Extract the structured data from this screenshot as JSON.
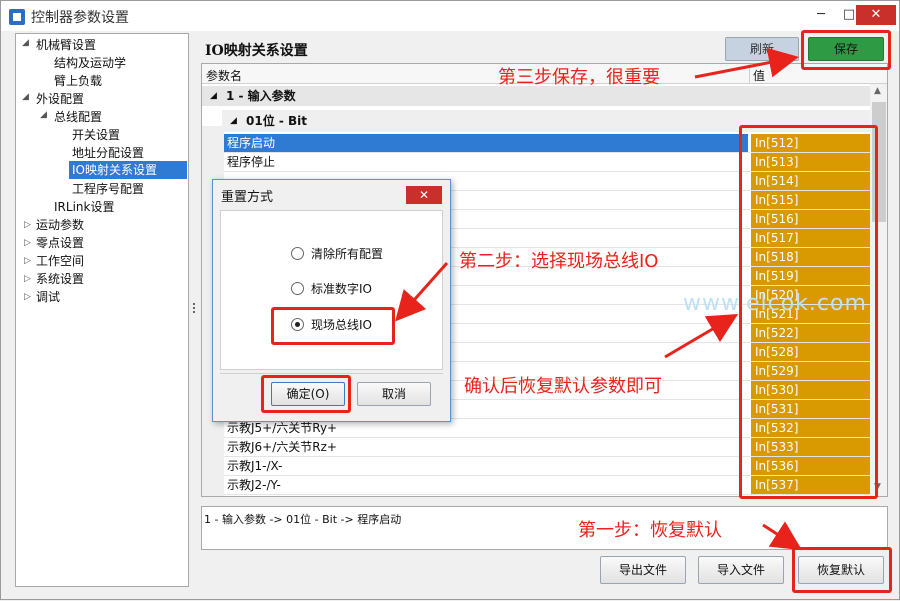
{
  "window": {
    "title": "控制器参数设置",
    "min_icon": "minimize-icon",
    "max_icon": "maximize-icon",
    "close_icon": "close-icon"
  },
  "sidebar": {
    "items": [
      {
        "label": "机械臂设置",
        "expanded": true
      },
      {
        "label": "结构及运动学"
      },
      {
        "label": "臂上负载"
      },
      {
        "label": "外设配置",
        "expanded": true
      },
      {
        "label": "总线配置",
        "expanded": true
      },
      {
        "label": "开关设置"
      },
      {
        "label": "地址分配设置"
      },
      {
        "label": "IO映射关系设置",
        "selected": true
      },
      {
        "label": "工程序号配置"
      },
      {
        "label": "IRLink设置"
      },
      {
        "label": "运动参数",
        "expanded": false
      },
      {
        "label": "零点设置",
        "expanded": false
      },
      {
        "label": "工作空间",
        "expanded": false
      },
      {
        "label": "系统设置",
        "expanded": false
      },
      {
        "label": "调试",
        "expanded": false
      }
    ]
  },
  "main": {
    "title": "IO映射关系设置",
    "refresh_label": "刷新",
    "save_label": "保存",
    "grid": {
      "col_name": "参数名",
      "col_value": "值",
      "group_label": "1 - 输入参数",
      "subgroup_label": "01位 - Bit",
      "rows": [
        {
          "name": "程序启动",
          "value": "In[512]",
          "selected": true
        },
        {
          "name": "程序停止",
          "value": "In[513]"
        },
        {
          "name": "",
          "value": "In[514]"
        },
        {
          "name": "",
          "value": "In[515]"
        },
        {
          "name": "",
          "value": "In[516]"
        },
        {
          "name": "",
          "value": "In[517]"
        },
        {
          "name": "",
          "value": "In[518]"
        },
        {
          "name": "",
          "value": "In[519]"
        },
        {
          "name": "",
          "value": "In[520]"
        },
        {
          "name": "",
          "value": "In[521]"
        },
        {
          "name": "",
          "value": "In[522]"
        },
        {
          "name": "",
          "value": "In[528]"
        },
        {
          "name": "",
          "value": "In[529]"
        },
        {
          "name": "",
          "value": "In[530]"
        },
        {
          "name": "",
          "value": "In[531]"
        },
        {
          "name": "示教J5+/六关节Ry+",
          "value": "In[532]"
        },
        {
          "name": "示教J6+/六关节Rz+",
          "value": "In[533]"
        },
        {
          "name": "示教J1-/X-",
          "value": "In[536]"
        },
        {
          "name": "示教J2-/Y-",
          "value": "In[537]"
        }
      ]
    },
    "description": "1 - 输入参数 -> 01位 - Bit -> 程序启动",
    "export_label": "导出文件",
    "import_label": "导入文件",
    "restore_label": "恢复默认"
  },
  "dialog": {
    "title": "重置方式",
    "options": [
      "清除所有配置",
      "标准数字IO",
      "现场总线IO"
    ],
    "selected_option": "现场总线IO",
    "ok_label": "确定(O)",
    "cancel_label": "取消"
  },
  "annotations": {
    "step1": "第一步：恢复默认",
    "step2": "第二步：选择现场总线IO",
    "step3": "第三步保存，很重要",
    "confirm": "确认后恢复默认参数即可",
    "color": "#e8231b"
  },
  "watermark": "www.elcok.com"
}
